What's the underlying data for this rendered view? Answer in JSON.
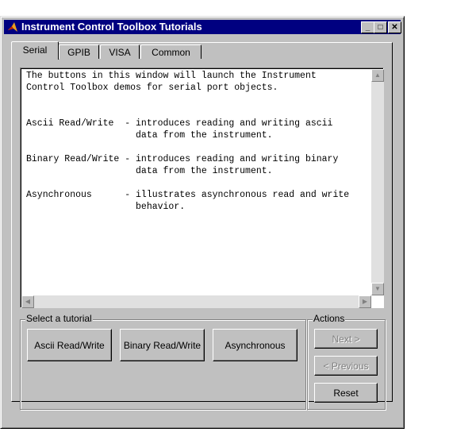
{
  "window": {
    "title": "Instrument Control Toolbox Tutorials"
  },
  "tabs": [
    {
      "label": "Serial",
      "active": true
    },
    {
      "label": "GPIB"
    },
    {
      "label": "VISA"
    },
    {
      "label": "Common"
    }
  ],
  "description": "The buttons in this window will launch the Instrument\nControl Toolbox demos for serial port objects.\n\n\nAscii Read/Write  - introduces reading and writing ascii\n                    data from the instrument.\n\nBinary Read/Write - introduces reading and writing binary\n                    data from the instrument.\n\nAsynchronous      - illustrates asynchronous read and write\n                    behavior.",
  "tutorial_group": {
    "label": "Select a tutorial",
    "buttons": [
      "Ascii Read/Write",
      "Binary Read/Write",
      "Asynchronous"
    ]
  },
  "actions_group": {
    "label": "Actions",
    "next": "Next >",
    "previous": "< Previous",
    "reset": "Reset"
  }
}
